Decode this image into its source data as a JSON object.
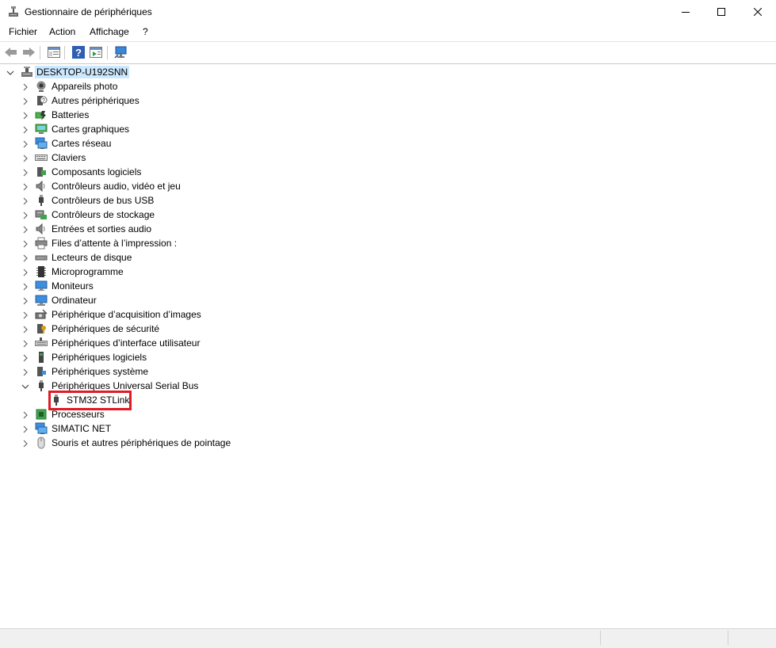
{
  "window": {
    "title": "Gestionnaire de périphériques"
  },
  "menu": [
    "Fichier",
    "Action",
    "Affichage",
    "?"
  ],
  "tree": {
    "root": "DESKTOP-U192SNN",
    "items": [
      {
        "label": "Appareils photo",
        "icon": "camera-icon"
      },
      {
        "label": "Autres périphériques",
        "icon": "unknown-device-icon"
      },
      {
        "label": "Batteries",
        "icon": "battery-icon"
      },
      {
        "label": "Cartes graphiques",
        "icon": "display-adapter-icon"
      },
      {
        "label": "Cartes réseau",
        "icon": "network-adapter-icon"
      },
      {
        "label": "Claviers",
        "icon": "keyboard-icon"
      },
      {
        "label": "Composants logiciels",
        "icon": "software-component-icon"
      },
      {
        "label": "Contrôleurs audio, vidéo et jeu",
        "icon": "speaker-icon"
      },
      {
        "label": "Contrôleurs de bus USB",
        "icon": "usb-plug-icon"
      },
      {
        "label": "Contrôleurs de stockage",
        "icon": "storage-controller-icon"
      },
      {
        "label": "Entrées et sorties audio",
        "icon": "speaker-icon"
      },
      {
        "label": "Files d’attente à l’impression :",
        "icon": "printer-icon"
      },
      {
        "label": "Lecteurs de disque",
        "icon": "disk-drive-icon"
      },
      {
        "label": "Microprogramme",
        "icon": "firmware-chip-icon"
      },
      {
        "label": "Moniteurs",
        "icon": "monitor-icon"
      },
      {
        "label": "Ordinateur",
        "icon": "computer-icon"
      },
      {
        "label": "Périphérique d’acquisition d’images",
        "icon": "scanner-camera-icon"
      },
      {
        "label": "Périphériques de sécurité",
        "icon": "security-key-icon"
      },
      {
        "label": "Périphériques d’interface utilisateur",
        "icon": "hid-icon"
      },
      {
        "label": "Périphériques logiciels",
        "icon": "software-device-icon"
      },
      {
        "label": "Périphériques système",
        "icon": "system-device-icon"
      },
      {
        "label": "Périphériques Universal Serial Bus",
        "icon": "usb-plug-icon",
        "expanded": true,
        "children": [
          {
            "label": "STM32 STLink",
            "icon": "usb-plug-icon"
          }
        ]
      },
      {
        "label": "Processeurs",
        "icon": "processor-icon"
      },
      {
        "label": "SIMATIC NET",
        "icon": "network-adapter-icon"
      },
      {
        "label": "Souris et autres périphériques de pointage",
        "icon": "mouse-icon"
      }
    ]
  },
  "colors": {
    "highlight": "#e01b24",
    "root_selection": "#cce8ff"
  }
}
